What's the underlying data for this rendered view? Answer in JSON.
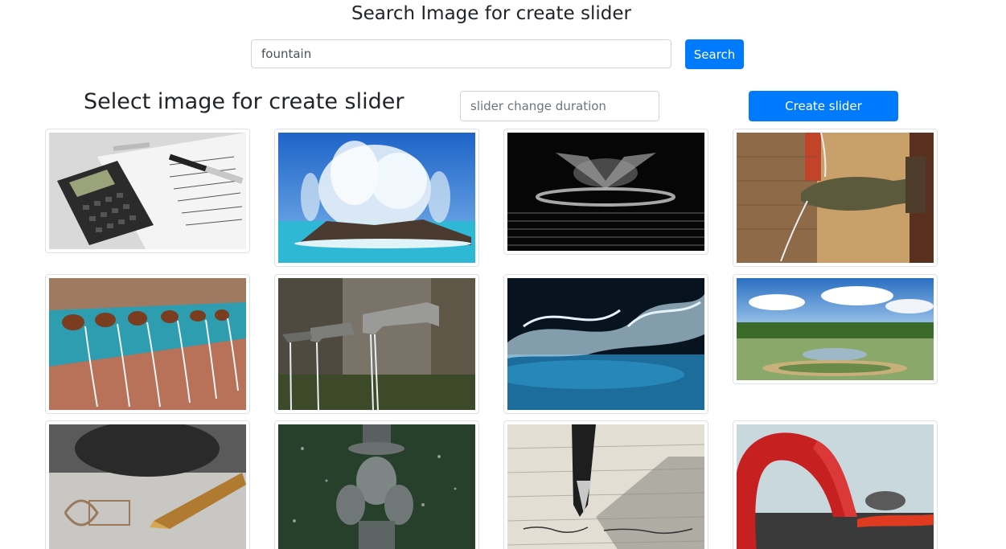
{
  "search": {
    "title": "Search Image for create slider",
    "query": "fountain",
    "button_label": "Search"
  },
  "slider": {
    "title": "Select image for create slider",
    "duration_placeholder": "slider change duration",
    "create_button_label": "Create slider"
  }
}
